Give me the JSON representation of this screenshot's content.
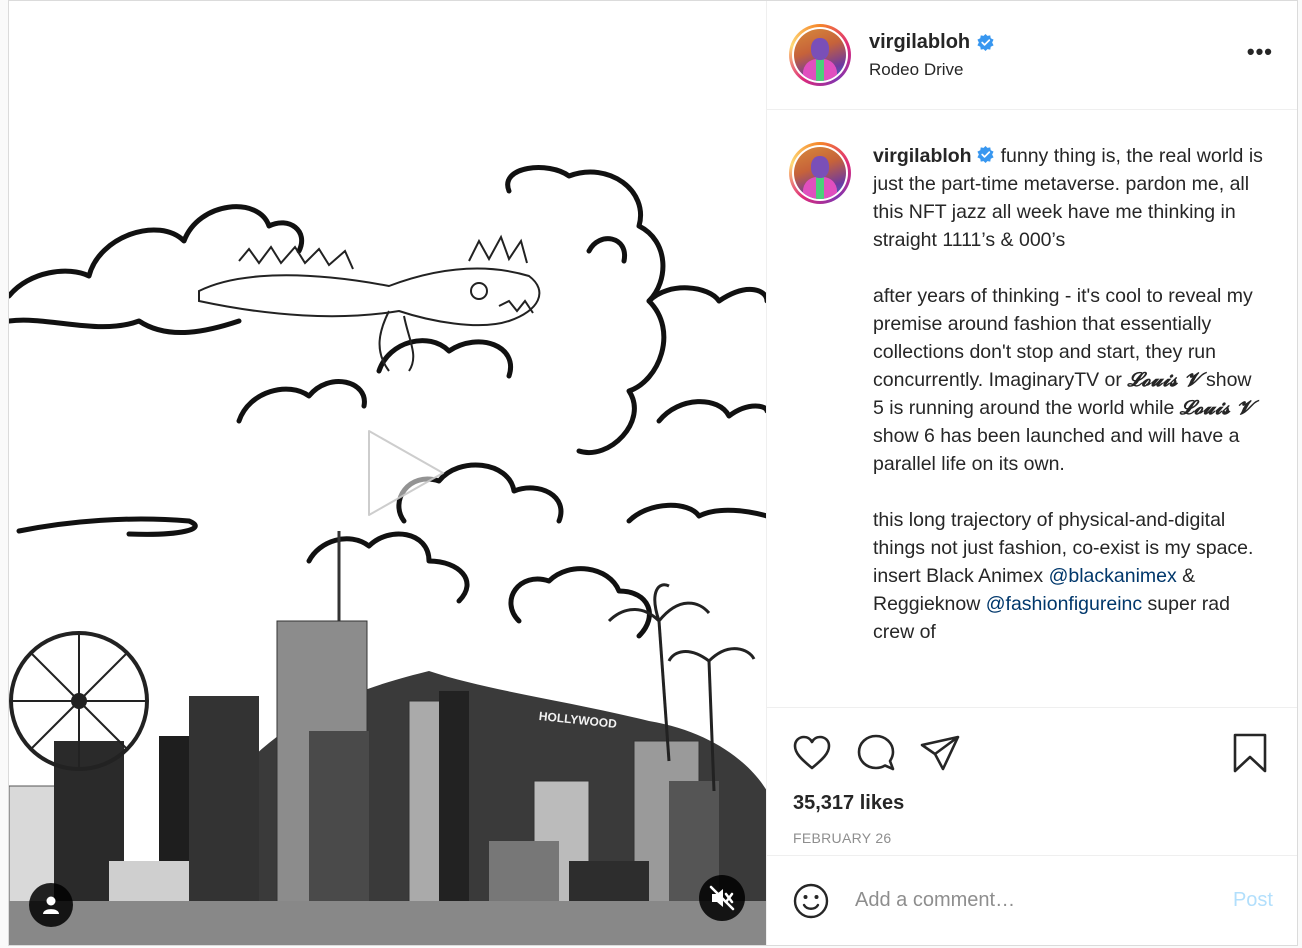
{
  "post": {
    "username": "virgilabloh",
    "location": "Rodeo Drive",
    "verified_icon": "verified-badge-icon",
    "more_label": "•••"
  },
  "caption": {
    "username": "virgilabloh",
    "p1": "funny thing is, the real world is just the part-time metaverse. pardon me, all this NFT jazz all week have me thinking in straight 1111’s & 000’s",
    "p2_a": "after years of thinking - it's cool to reveal my premise around fashion that essentially collections don't stop and start, they run concurrently. ImaginaryTV or ",
    "p2_louis1": "𝓛𝓸𝓾𝓲𝓼 𝓥",
    "p2_b": " show 5 is running around the world while ",
    "p2_louis2": "𝓛𝓸𝓾𝓲𝓼 𝓥",
    "p2_c": " show 6 has been launched and will have a parallel life on its own.",
    "p3_a": "this long trajectory of physical-and-digital things not just fashion, co-exist is my space. insert Black Animex ",
    "p3_mention1": "@blackanimex",
    "p3_b": " & Reggieknow ",
    "p3_mention2": "@fashionfigureinc",
    "p3_c": " super rad crew of"
  },
  "media": {
    "sign_text": "HOLLYWOOD",
    "icons": {
      "play": "play-icon",
      "next": "chevron-right-icon",
      "tag": "user-tag-icon",
      "mute": "volume-muted-icon"
    }
  },
  "actions": {
    "like_icon": "heart-icon",
    "comment_icon": "comment-icon",
    "share_icon": "send-icon",
    "save_icon": "bookmark-icon",
    "likes": "35,317 likes",
    "date": "FEBRUARY 26"
  },
  "comment_box": {
    "placeholder": "Add a comment…",
    "post_label": "Post",
    "emoji_icon": "emoji-icon"
  },
  "colors": {
    "verified": "#3897f0",
    "link": "#00376b",
    "post_disabled": "#b2dffc",
    "border": "#dbdbdb"
  }
}
